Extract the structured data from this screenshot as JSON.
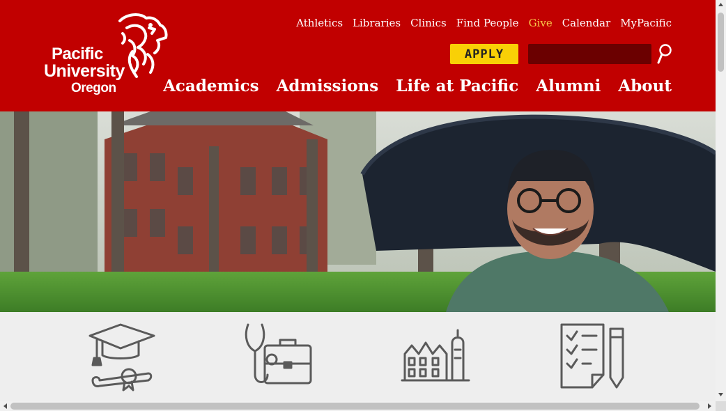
{
  "header": {
    "logo": {
      "line1": "Pacific",
      "line2": "University",
      "line3": "Oregon"
    },
    "utility_nav": [
      {
        "label": "Athletics"
      },
      {
        "label": "Libraries"
      },
      {
        "label": "Clinics"
      },
      {
        "label": "Find People"
      },
      {
        "label": "Give",
        "color": "#f7c548"
      },
      {
        "label": "Calendar"
      },
      {
        "label": "MyPacific"
      }
    ],
    "apply_label": "APPLY",
    "search": {
      "value": "",
      "placeholder": ""
    },
    "main_nav": [
      {
        "label": "Academics"
      },
      {
        "label": "Admissions"
      },
      {
        "label": "Life at Pacific"
      },
      {
        "label": "Alumni"
      },
      {
        "label": "About"
      }
    ]
  },
  "features": [
    {
      "icon": "graduation-cap-diploma-icon"
    },
    {
      "icon": "stethoscope-briefcase-icon"
    },
    {
      "icon": "campus-building-icon"
    },
    {
      "icon": "checklist-pencil-icon"
    }
  ],
  "colors": {
    "brand_red": "#c10000",
    "search_bg": "#6b0000",
    "apply_yellow": "#f9d006",
    "give_gold": "#f7c548",
    "icon_gray": "#5a5a5a"
  }
}
